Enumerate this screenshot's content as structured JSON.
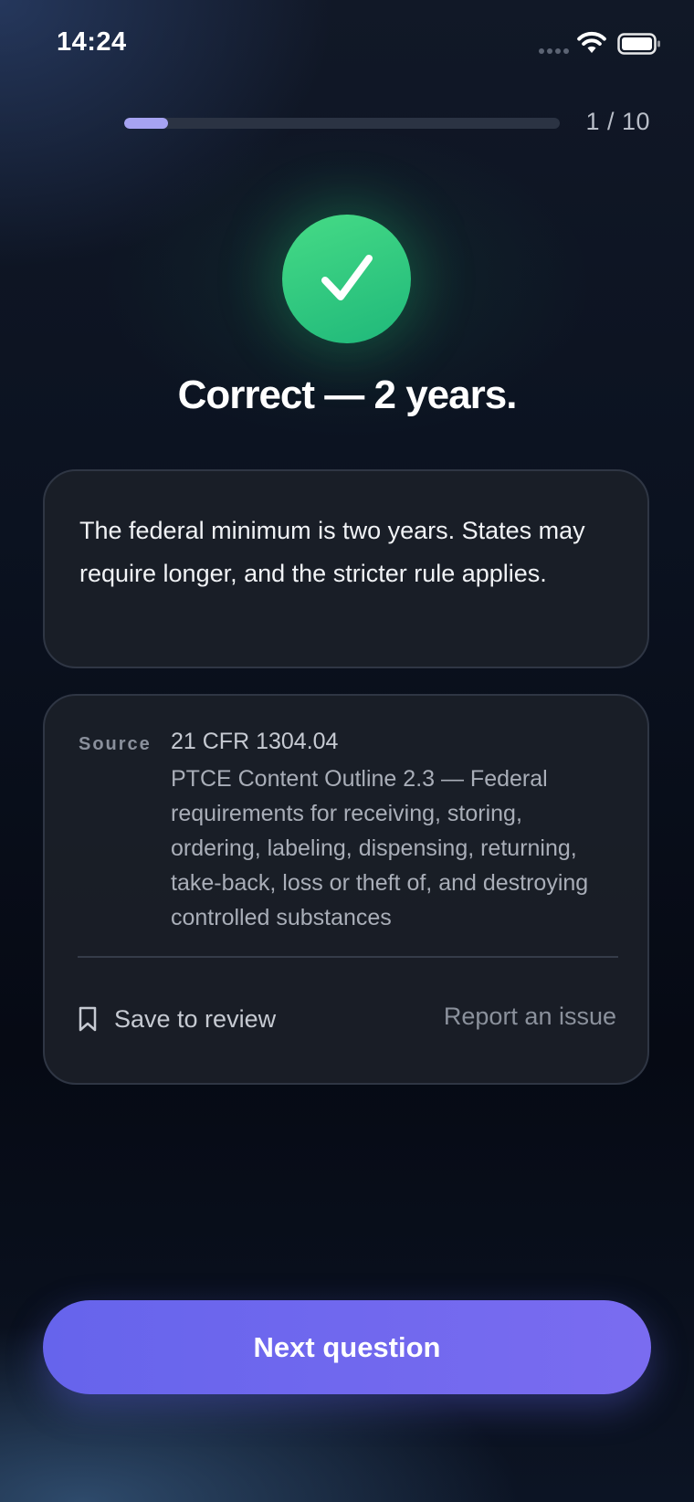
{
  "status_bar": {
    "time": "14:24",
    "icons": [
      "signal-dots-icon",
      "wifi-icon",
      "battery-icon"
    ]
  },
  "progress": {
    "label": "1 / 10",
    "current": 1,
    "total": 10,
    "fill_fraction": 0.1
  },
  "result": {
    "icon": "checkmark-icon",
    "title": "Correct — 2 years.",
    "colors": {
      "success": "#22c56e",
      "accent": "#6c67ef"
    }
  },
  "explanation": {
    "text": "The federal minimum is two years. States may require longer, and the stricter rule applies."
  },
  "source": {
    "label": "Source",
    "reference": "21 CFR 1304.04",
    "description": "PTCE Content Outline 2.3 — Federal requirements for receiving, storing, ordering, labeling, dispensing, returning, take-back, loss or theft of, and destroying controlled substances"
  },
  "actions": {
    "save_icon": "bookmark-icon",
    "save_label": "Save to review",
    "report_label": "Report an issue",
    "next_label": "Next question"
  }
}
